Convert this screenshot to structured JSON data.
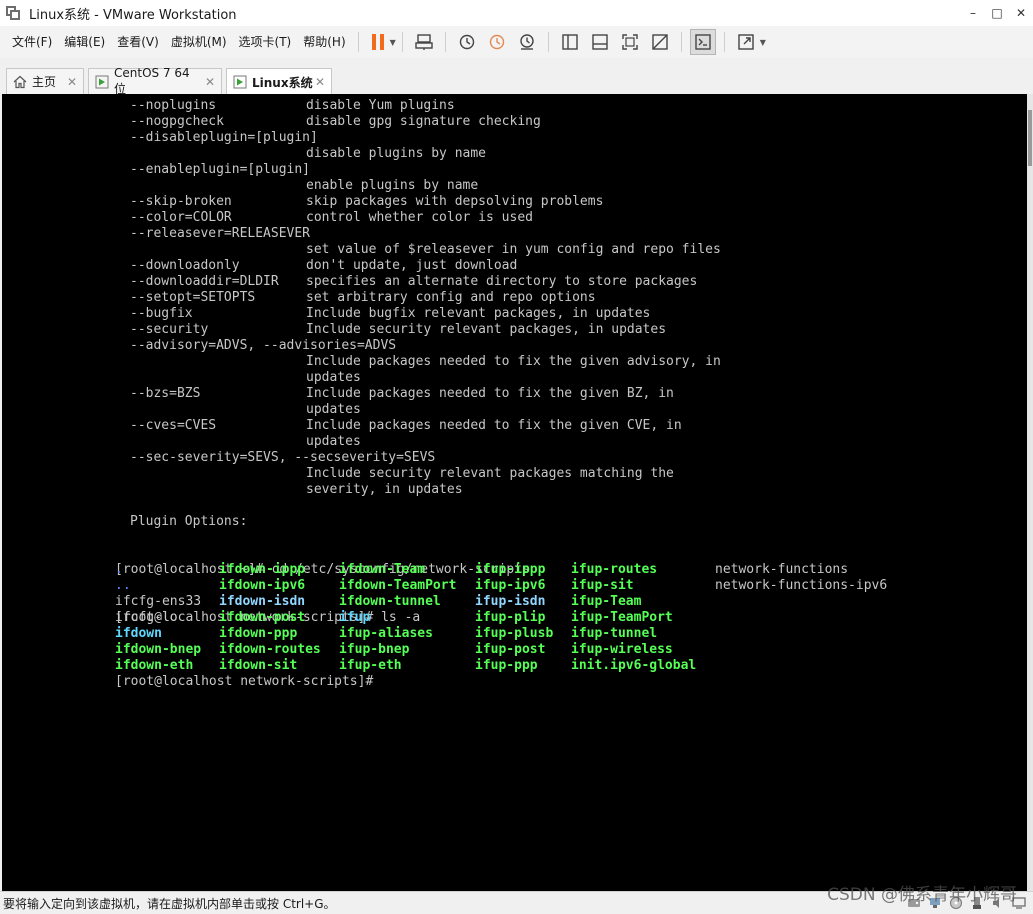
{
  "window": {
    "title": "Linux系统 - VMware Workstation",
    "minimize": "–",
    "maximize": "□",
    "close": "✕"
  },
  "menu": {
    "items": [
      "文件(F)",
      "编辑(E)",
      "查看(V)",
      "虚拟机(M)",
      "选项卡(T)",
      "帮助(H)"
    ]
  },
  "tabs": [
    {
      "label": "主页",
      "icon": "home-icon",
      "active": false
    },
    {
      "label": "CentOS 7 64 位",
      "icon": "vm-icon",
      "active": false
    },
    {
      "label": "Linux系统",
      "icon": "vm-icon",
      "active": true
    }
  ],
  "console": {
    "help_lines": [
      [
        "--noplugins",
        "disable Yum plugins"
      ],
      [
        "--nogpgcheck",
        "disable gpg signature checking"
      ],
      [
        "--disableplugin=[plugin]",
        ""
      ],
      [
        "",
        "disable plugins by name"
      ],
      [
        "--enableplugin=[plugin]",
        ""
      ],
      [
        "",
        "enable plugins by name"
      ],
      [
        "--skip-broken",
        "skip packages with depsolving problems"
      ],
      [
        "--color=COLOR",
        "control whether color is used"
      ],
      [
        "--releasever=RELEASEVER",
        ""
      ],
      [
        "",
        "set value of $releasever in yum config and repo files"
      ],
      [
        "--downloadonly",
        "don't update, just download"
      ],
      [
        "--downloaddir=DLDIR",
        "specifies an alternate directory to store packages"
      ],
      [
        "--setopt=SETOPTS",
        "set arbitrary config and repo options"
      ],
      [
        "--bugfix",
        "Include bugfix relevant packages, in updates"
      ],
      [
        "--security",
        "Include security relevant packages, in updates"
      ],
      [
        "--advisory=ADVS, --advisories=ADVS",
        ""
      ],
      [
        "",
        "Include packages needed to fix the given advisory, in"
      ],
      [
        "",
        "updates"
      ],
      [
        "--bzs=BZS",
        "Include packages needed to fix the given BZ, in"
      ],
      [
        "",
        "updates"
      ],
      [
        "--cves=CVES",
        "Include packages needed to fix the given CVE, in"
      ],
      [
        "",
        "updates"
      ],
      [
        "--sec-severity=SEVS, --secseverity=SEVS",
        ""
      ],
      [
        "",
        "Include security relevant packages matching the"
      ],
      [
        "",
        "severity, in updates"
      ],
      [
        "",
        ""
      ],
      [
        "Plugin Options:",
        ""
      ]
    ],
    "prompt_lines": [
      "[root@localhost ~]# cd /etc/sysconfig/network-scripts",
      "[root@localhost network-scripts]# ls -a"
    ],
    "ls_rows": [
      [
        {
          "t": ".",
          "c": "blue"
        },
        {
          "t": "ifdown-ippp",
          "c": "green"
        },
        {
          "t": "ifdown-Team",
          "c": "green"
        },
        {
          "t": "ifup-ippp",
          "c": "green"
        },
        {
          "t": "ifup-routes",
          "c": "green"
        },
        {
          "t": "network-functions",
          "c": "white"
        }
      ],
      [
        {
          "t": "..",
          "c": "blue"
        },
        {
          "t": "ifdown-ipv6",
          "c": "green"
        },
        {
          "t": "ifdown-TeamPort",
          "c": "green"
        },
        {
          "t": "ifup-ipv6",
          "c": "green"
        },
        {
          "t": "ifup-sit",
          "c": "green"
        },
        {
          "t": "network-functions-ipv6",
          "c": "white"
        }
      ],
      [
        {
          "t": "ifcfg-ens33",
          "c": "white"
        },
        {
          "t": "ifdown-isdn",
          "c": "isdn"
        },
        {
          "t": "ifdown-tunnel",
          "c": "green"
        },
        {
          "t": "ifup-isdn",
          "c": "isdn"
        },
        {
          "t": "ifup-Team",
          "c": "green"
        },
        {
          "t": "",
          "c": "white"
        }
      ],
      [
        {
          "t": "ifcfg-lo",
          "c": "white"
        },
        {
          "t": "ifdown-post",
          "c": "green"
        },
        {
          "t": "ifup",
          "c": "cyan"
        },
        {
          "t": "ifup-plip",
          "c": "green"
        },
        {
          "t": "ifup-TeamPort",
          "c": "green"
        },
        {
          "t": "",
          "c": "white"
        }
      ],
      [
        {
          "t": "ifdown",
          "c": "cyan"
        },
        {
          "t": "ifdown-ppp",
          "c": "green"
        },
        {
          "t": "ifup-aliases",
          "c": "green"
        },
        {
          "t": "ifup-plusb",
          "c": "green"
        },
        {
          "t": "ifup-tunnel",
          "c": "green"
        },
        {
          "t": "",
          "c": "white"
        }
      ],
      [
        {
          "t": "ifdown-bnep",
          "c": "green"
        },
        {
          "t": "ifdown-routes",
          "c": "green"
        },
        {
          "t": "ifup-bnep",
          "c": "green"
        },
        {
          "t": "ifup-post",
          "c": "green"
        },
        {
          "t": "ifup-wireless",
          "c": "green"
        },
        {
          "t": "",
          "c": "white"
        }
      ],
      [
        {
          "t": "ifdown-eth",
          "c": "green"
        },
        {
          "t": "ifdown-sit",
          "c": "green"
        },
        {
          "t": "ifup-eth",
          "c": "green"
        },
        {
          "t": "ifup-ppp",
          "c": "green"
        },
        {
          "t": "init.ipv6-global",
          "c": "green"
        },
        {
          "t": "",
          "c": "white"
        }
      ]
    ],
    "final_prompt": "[root@localhost network-scripts]#"
  },
  "statusbar": {
    "text": "要将输入定向到该虚拟机，请在虚拟机内部单击或按 Ctrl+G。",
    "watermark": "CSDN @佛系青年小辉哥"
  },
  "colors": {
    "ls_green": "#55ff55",
    "ls_blue": "#5f87ff",
    "ls_cyan": "#5fd7ff",
    "pause_orange": "#f26b1d"
  }
}
